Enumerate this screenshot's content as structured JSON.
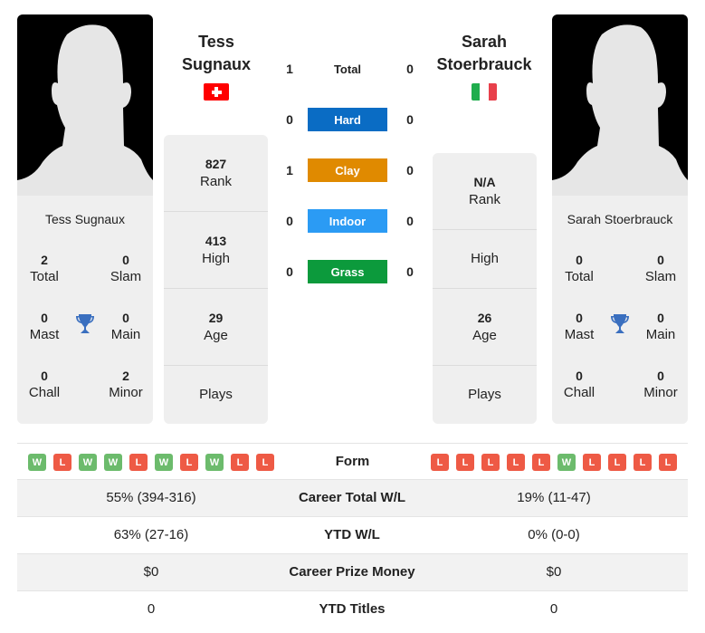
{
  "player_left": {
    "name_line1": "Tess",
    "name_line2": "Sugnaux",
    "full_name": "Tess Sugnaux",
    "country": "Switzerland",
    "flag_colors": {
      "bg": "#ff0000",
      "cross": "#ffffff"
    },
    "titles": {
      "total": {
        "value": "2",
        "label": "Total"
      },
      "slam": {
        "value": "0",
        "label": "Slam"
      },
      "mast": {
        "value": "0",
        "label": "Mast"
      },
      "main": {
        "value": "0",
        "label": "Main"
      },
      "chall": {
        "value": "0",
        "label": "Chall"
      },
      "minor": {
        "value": "2",
        "label": "Minor"
      }
    },
    "stats": {
      "rank": {
        "value": "827",
        "label": "Rank"
      },
      "high": {
        "value": "413",
        "label": "High"
      },
      "age": {
        "value": "29",
        "label": "Age"
      },
      "plays": {
        "value": "",
        "label": "Plays"
      }
    },
    "form": [
      "W",
      "L",
      "W",
      "W",
      "L",
      "W",
      "L",
      "W",
      "L",
      "L"
    ]
  },
  "player_right": {
    "name_line1": "Sarah",
    "name_line2": "Stoerbrauck",
    "full_name": "Sarah Stoerbrauck",
    "country": "Italy",
    "flag_colors": {
      "green": "#009246",
      "white": "#ffffff",
      "red": "#ce2b37"
    },
    "titles": {
      "total": {
        "value": "0",
        "label": "Total"
      },
      "slam": {
        "value": "0",
        "label": "Slam"
      },
      "mast": {
        "value": "0",
        "label": "Mast"
      },
      "main": {
        "value": "0",
        "label": "Main"
      },
      "chall": {
        "value": "0",
        "label": "Chall"
      },
      "minor": {
        "value": "0",
        "label": "Minor"
      }
    },
    "stats": {
      "rank": {
        "value": "N/A",
        "label": "Rank"
      },
      "high": {
        "value": "",
        "label": "High"
      },
      "age": {
        "value": "26",
        "label": "Age"
      },
      "plays": {
        "value": "",
        "label": "Plays"
      }
    },
    "form": [
      "L",
      "L",
      "L",
      "L",
      "L",
      "W",
      "L",
      "L",
      "L",
      "L"
    ]
  },
  "h2h": [
    {
      "label": "Total",
      "left": "1",
      "right": "0",
      "color": null
    },
    {
      "label": "Hard",
      "left": "0",
      "right": "0",
      "color": "#0a6cc4"
    },
    {
      "label": "Clay",
      "left": "1",
      "right": "0",
      "color": "#e08a00"
    },
    {
      "label": "Indoor",
      "left": "0",
      "right": "0",
      "color": "#2b9bf4"
    },
    {
      "label": "Grass",
      "left": "0",
      "right": "0",
      "color": "#0c9a3c"
    }
  ],
  "form_label": "Form",
  "form_colors": {
    "W": "#6cbb6c",
    "L": "#ee5a45"
  },
  "comparison": [
    {
      "label": "Career Total W/L",
      "left": "55% (394-316)",
      "right": "19% (11-47)"
    },
    {
      "label": "YTD W/L",
      "left": "63% (27-16)",
      "right": "0% (0-0)"
    },
    {
      "label": "Career Prize Money",
      "left": "$0",
      "right": "$0"
    },
    {
      "label": "YTD Titles",
      "left": "0",
      "right": "0"
    }
  ],
  "colors": {
    "trophy": "#3a6fbf",
    "card_bg": "#efefef"
  }
}
